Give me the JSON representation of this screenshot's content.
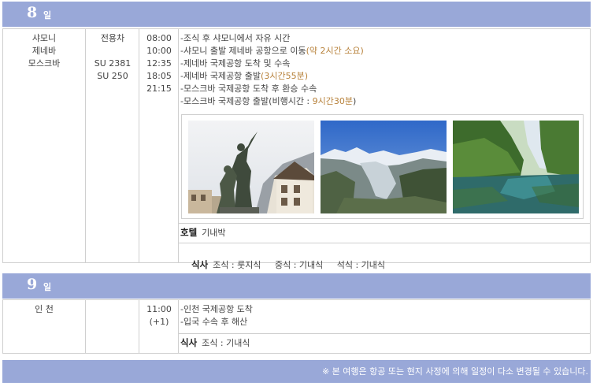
{
  "day8": {
    "number": "8",
    "unit": "일",
    "cities": [
      "샤모니",
      "제네바",
      "모스크바"
    ],
    "transports": [
      "전용차",
      "",
      "SU 2381",
      "SU 250"
    ],
    "times": [
      "08:00",
      "10:00",
      "12:35",
      "18:05",
      "21:15"
    ],
    "schedule": [
      {
        "text": "-조식 후 샤모니에서 자유 시간"
      },
      {
        "text": "-샤모니 출발 제네바 공항으로 이동",
        "note": "(약 2시간 소요)"
      },
      {
        "text": "-제네바 국제공항 도착 및 수속"
      },
      {
        "text": "-제네바 국제공항 출발",
        "note": "(3시간55분)"
      },
      {
        "text": "-모스크바 국제공항 도착 후 환승 수속"
      },
      {
        "text": "-모스크바 국제공항 출발(비행시간 : ",
        "note": "9시간30분",
        "tail": ")"
      }
    ],
    "hotel_label": "호텔",
    "hotel_value": "기내박",
    "meal_label": "식사",
    "meals": "조식 : 룻지식     중식 : 기내식     석식 : 기내식"
  },
  "day9": {
    "number": "9",
    "unit": "일",
    "city": "인 천",
    "times": [
      "11:00",
      "(+1)"
    ],
    "schedule": [
      "-인천 국제공항 도착",
      "-입국 수속 후 해산"
    ],
    "meal_label": "식사",
    "meals": "조식 : 기내식"
  },
  "notice": "※ 본 여행은 항공 또는 현지 사정에 의해 일정이 다소 변경될 수 있습니다.",
  "colors": {
    "header": "#99a8d8",
    "highlight": "#b7813a",
    "border": "#cfcfcf"
  }
}
